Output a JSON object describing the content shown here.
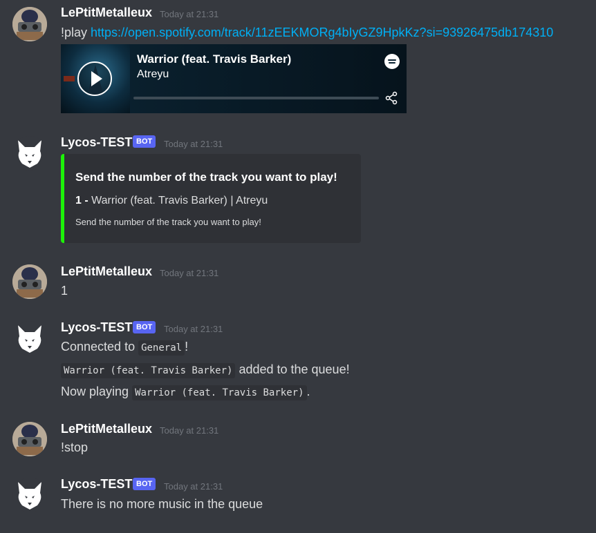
{
  "messages": {
    "m1": {
      "username": "LePtitMetalleux",
      "timestamp": "Today at 21:31",
      "prefix": "!play ",
      "link": "https://open.spotify.com/track/11zEEKMORg4bIyGZ9HpkKz?si=93926475db174310",
      "spotify": {
        "title": "Warrior (feat. Travis Barker)",
        "artist": "Atreyu",
        "logo_icon": "spotify-icon",
        "share_icon": "share-icon",
        "play_icon": "play-icon"
      }
    },
    "m2": {
      "username": "Lycos-TEST",
      "bot_tag": "BOT",
      "timestamp": "Today at 21:31",
      "embed": {
        "title": "Send the number of the track you want to play!",
        "item_number": "1 -",
        "item_text": " Warrior (feat. Travis Barker) | Atreyu",
        "footer": "Send the number of the track you want to play!",
        "accent_color": "#1df109"
      }
    },
    "m3": {
      "username": "LePtitMetalleux",
      "timestamp": "Today at 21:31",
      "text": "1"
    },
    "m4": {
      "username": "Lycos-TEST",
      "bot_tag": "BOT",
      "timestamp": "Today at 21:31",
      "line1_pre": "Connected to ",
      "line1_code": "General",
      "line1_post": "!",
      "line2_code": "Warrior (feat. Travis Barker)",
      "line2_post": " added to the queue!",
      "line3_pre": "Now playing ",
      "line3_code": "Warrior (feat. Travis Barker)",
      "line3_post": "."
    },
    "m5": {
      "username": "LePtitMetalleux",
      "timestamp": "Today at 21:31",
      "text": "!stop"
    },
    "m6": {
      "username": "Lycos-TEST",
      "bot_tag": "BOT",
      "timestamp": "Today at 21:31",
      "text": "There is no more music in the queue"
    }
  },
  "colors": {
    "background": "#36393f",
    "link": "#00aff4",
    "bot_tag": "#5865f2",
    "embed_accent": "#1df109"
  }
}
